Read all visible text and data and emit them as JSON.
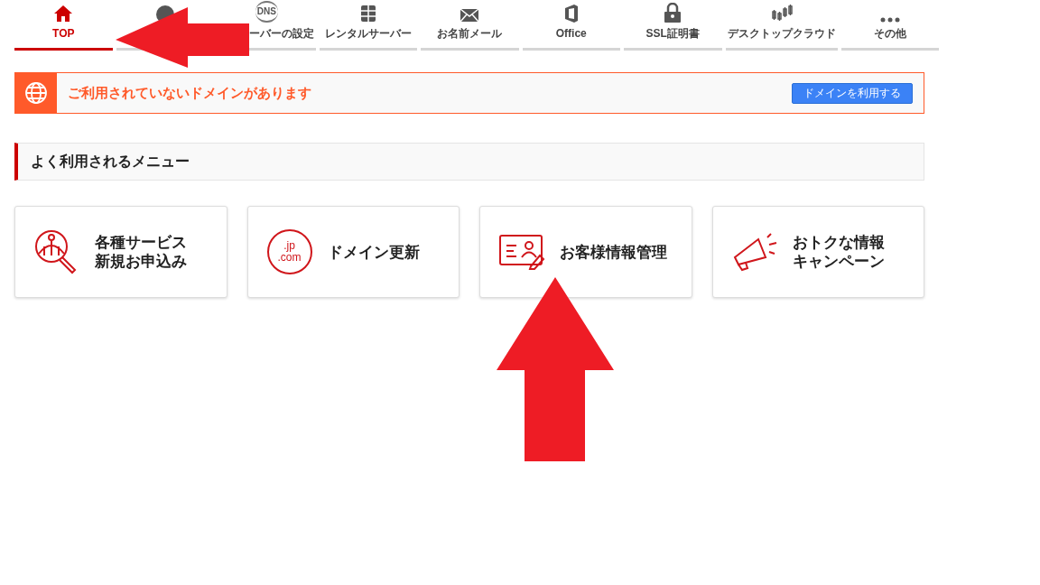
{
  "nav_tabs": [
    {
      "kind": "home",
      "label": "TOP",
      "selected": true
    },
    {
      "kind": "globe",
      "selected": false
    },
    {
      "kind": "dns",
      "icon_text": "DNS",
      "label": "ーバーの設定",
      "selected": false
    },
    {
      "kind": "server",
      "label": "レンタルサーバー",
      "selected": false
    },
    {
      "kind": "mail",
      "label": "お名前メール",
      "selected": false
    },
    {
      "kind": "office",
      "label": "Office",
      "selected": false
    },
    {
      "kind": "lock",
      "label": "SSL証明書",
      "selected": false
    },
    {
      "kind": "chart",
      "label": "デスクトップクラウド",
      "selected": false
    },
    {
      "kind": "more",
      "label": "その他",
      "selected": false
    }
  ],
  "alert": {
    "message": "ご利用されていないドメインがあります",
    "button": "ドメインを利用する"
  },
  "section": {
    "title": "よく利用されるメニュー"
  },
  "menu_cards": [
    {
      "kind": "search-map",
      "lines": [
        "各種サービス",
        "新規お申込み"
      ]
    },
    {
      "kind": "domain",
      "icon_text": [
        ".jp",
        ".com"
      ],
      "lines": [
        "ドメイン更新"
      ]
    },
    {
      "kind": "profile",
      "lines": [
        "お客様情報管理"
      ]
    },
    {
      "kind": "megaphone",
      "lines": [
        "おトクな情報",
        "キャンペーン"
      ]
    }
  ]
}
